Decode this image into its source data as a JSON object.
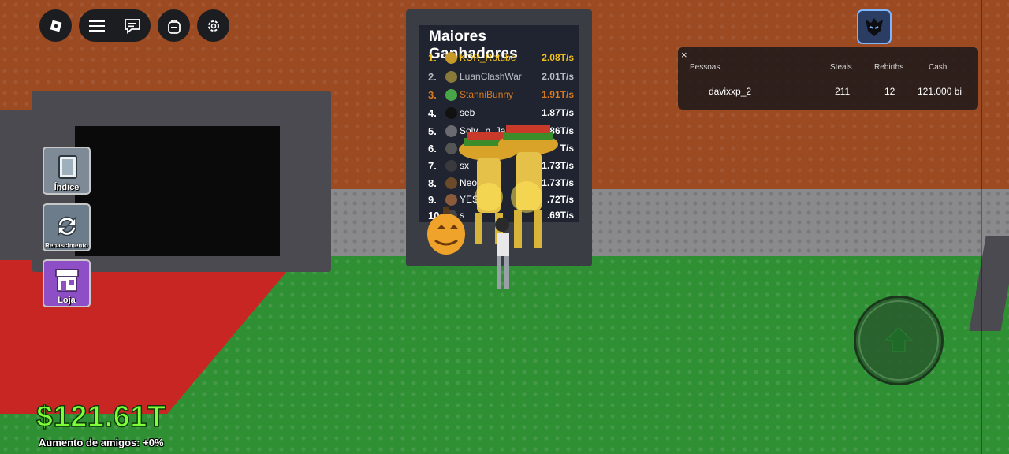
{
  "topbar": {
    "roblox_icon": "roblox-logo-icon",
    "menu_icon": "hamburger-menu-icon",
    "chat_icon": "chat-icon",
    "backpack_icon": "backpack-icon",
    "settings_icon": "gear-icon"
  },
  "leaderboard": {
    "title": "Maiores Ganhadores",
    "rows": [
      {
        "rank": "1.",
        "name": "KOR_Rotube",
        "rate": "2.08T/s"
      },
      {
        "rank": "2.",
        "name": "LuanClashWar",
        "rate": "2.01T/s"
      },
      {
        "rank": "3.",
        "name": "StanniBunny",
        "rate": "1.91T/s"
      },
      {
        "rank": "4.",
        "name": "seb",
        "rate": "1.87T/s"
      },
      {
        "rank": "5.",
        "name": "Solv...n_Ja",
        "rate": ".86T/s"
      },
      {
        "rank": "6.",
        "name": "cl",
        "rate": "T/s"
      },
      {
        "rank": "7.",
        "name": "sx",
        "rate": "1.73T/s"
      },
      {
        "rank": "8.",
        "name": "Neo",
        "rate": "1.73T/s"
      },
      {
        "rank": "9.",
        "name": "YES",
        "rate": ".72T/s"
      },
      {
        "rank": "10.",
        "name": "s",
        "rate": ".69T/s"
      }
    ]
  },
  "players_panel": {
    "close": "×",
    "headers": {
      "people": "Pessoas",
      "steals": "Steals",
      "rebirths": "Rebirths",
      "cash": "Cash"
    },
    "row": {
      "name": "davixxp_2",
      "steals": "211",
      "rebirths": "12",
      "cash": "121.000 bi"
    }
  },
  "side_menu": {
    "index_label": "Índice",
    "rebirth_label": "Renascimento",
    "shop_label": "Loja",
    "colors": {
      "index": "#7e8b96",
      "rebirth": "#6d7c8a",
      "shop": "#8e4fc6"
    }
  },
  "jump_button_icon": "up-arrow-icon",
  "hud": {
    "cash": "$121.61T",
    "friends_boost": "Aumento de amigos: +0%"
  }
}
